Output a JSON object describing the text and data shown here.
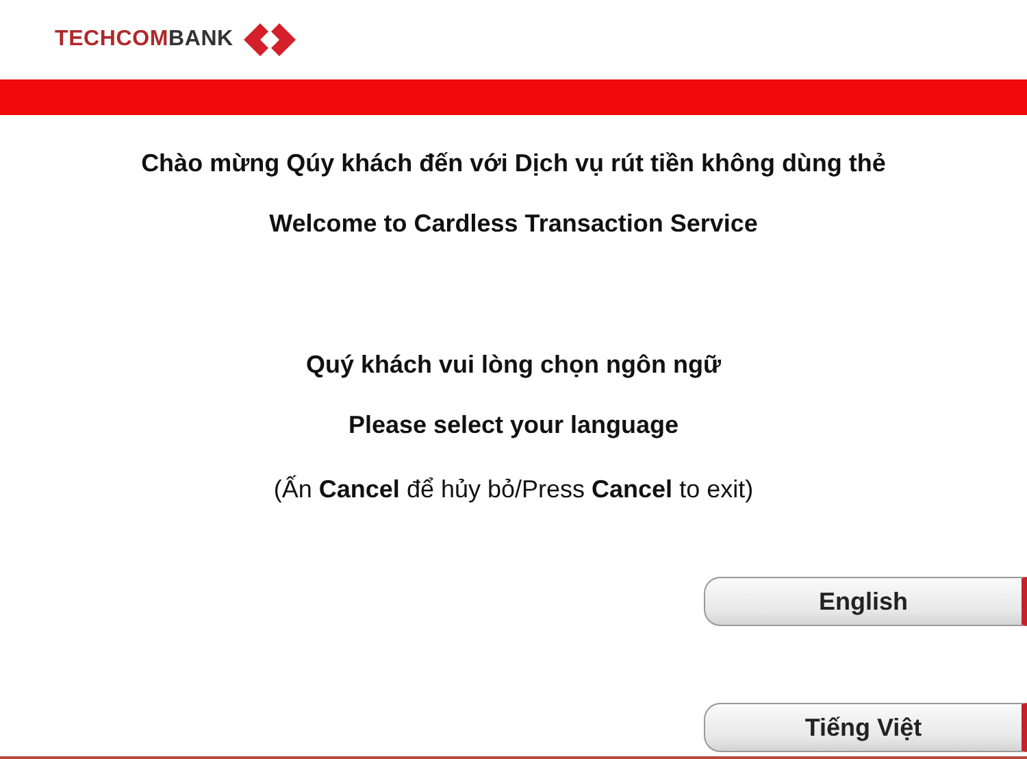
{
  "logo": {
    "parts": [
      {
        "text": "TECHCOM",
        "color": "#b0282c"
      },
      {
        "text": "BANK",
        "color": "#333333"
      }
    ]
  },
  "welcome": [
    "Chào mừng Qúy khách đến với Dịch vụ rút tiền không dùng thẻ",
    "Welcome to Cardless Transaction Service"
  ],
  "prompt": [
    "Quý khách vui lòng chọn ngôn ngữ",
    "Please select your language"
  ],
  "instruction": "(Ấn **Cancel** để hủy bỏ/Press **Cancel** to exit)",
  "buttons": [
    {
      "label": "English"
    },
    {
      "label": "Tiếng Việt"
    }
  ]
}
